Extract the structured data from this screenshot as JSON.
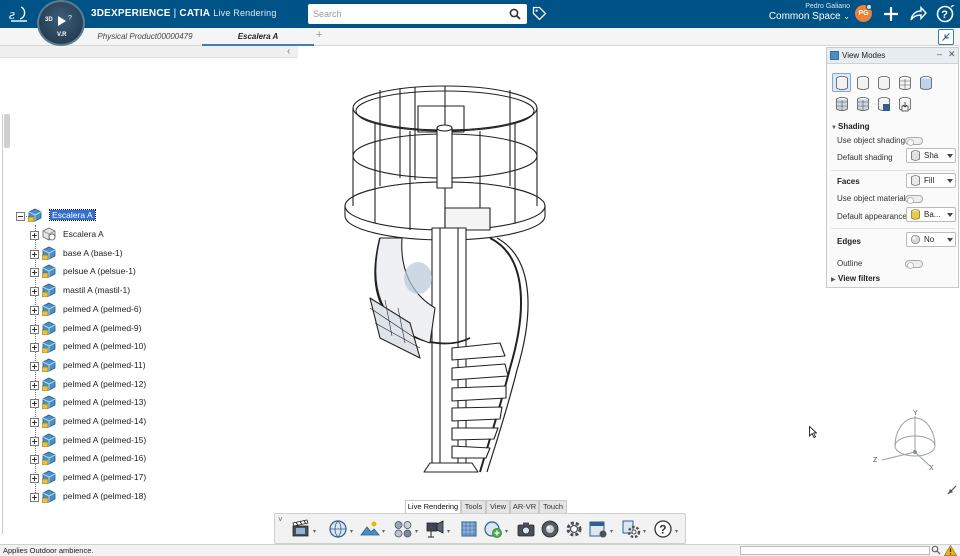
{
  "header": {
    "brand": "3DEXPERIENCE",
    "separator": " | ",
    "product": "CATIA",
    "app": "Live Rendering",
    "compass_top": "3D",
    "compass_label": "3D",
    "compass_version": "V.R",
    "compass_help": "?",
    "search_placeholder": "Search",
    "user_name": "Pedro Galiano",
    "collab_space": "Common Space",
    "avatar_initials": "PG"
  },
  "tabs": [
    {
      "label": "Physical Product00000479"
    },
    {
      "label": "Escalera A"
    }
  ],
  "tab_add": "+",
  "tree": {
    "collapse_glyph": "‹",
    "root": "Escalera A",
    "children": [
      "Escalera A",
      "base A (base-1)",
      "pelsue A (pelsue-1)",
      "mastil A (mastil-1)",
      "pelmed A (pelmed-6)",
      "pelmed A (pelmed-9)",
      "pelmed A (pelmed-10)",
      "pelmed A (pelmed-11)",
      "pelmed A (pelmed-12)",
      "pelmed A (pelmed-13)",
      "pelmed A (pelmed-14)",
      "pelmed A (pelmed-15)",
      "pelmed A (pelmed-16)",
      "pelmed A (pelmed-17)",
      "pelmed A (pelmed-18)"
    ]
  },
  "view_modes": {
    "title": "View Modes",
    "minimize": "–",
    "close": "✕",
    "shading": {
      "title": "Shading",
      "use_object_shading": "Use object shading",
      "default_shading_label": "Default shading",
      "default_shading_value": "Sha"
    },
    "faces": {
      "title": "Faces",
      "style_value": "Fill",
      "use_object_material": "Use object material",
      "default_appearance_label": "Default appearance",
      "default_appearance_value": "Ba..."
    },
    "edges": {
      "title": "Edges",
      "value": "No",
      "outline": "Outline"
    },
    "view_filters": "View filters"
  },
  "triad": {
    "x": "X",
    "y": "Y",
    "z": "Z"
  },
  "action_bar": {
    "tabs": [
      "Live Rendering",
      "Tools",
      "View",
      "AR-VR",
      "Touch"
    ],
    "chevron": "˅"
  },
  "status": {
    "message": "Applies Outdoor ambience."
  },
  "colors": {
    "topbar": "#005386",
    "selection": "#2f6fd0",
    "avatar": "#e8833a",
    "warning": "#f2b705"
  }
}
